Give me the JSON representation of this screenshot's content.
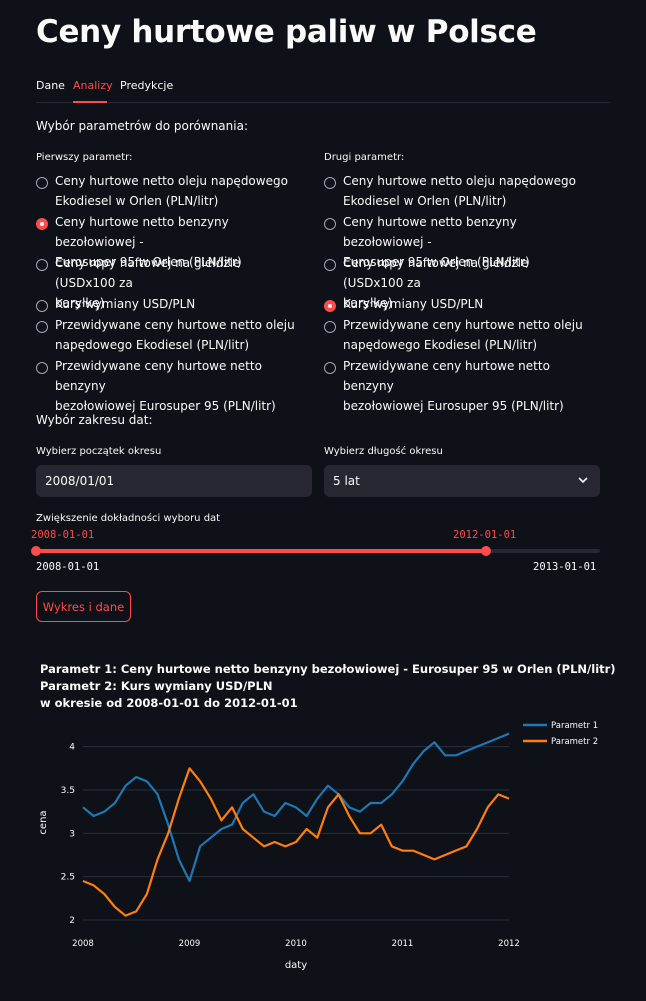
{
  "title": "Ceny hurtowe paliw w Polsce",
  "tabs": [
    "Dane",
    "Analizy",
    "Predykcje"
  ],
  "section_compare": "Wybór parametrów do porównania:",
  "first_param_label": "Pierwszy parametr:",
  "second_param_label": "Drugi parametr:",
  "options": {
    "o1": [
      "Ceny hurtowe netto oleju napędowego",
      "Ekodiesel w Orlen (PLN/litr)"
    ],
    "o2": [
      "Ceny hurtowe netto benzyny bezołowiowej -",
      "Eurosuper 95 w Orlen (PLN/litr)"
    ],
    "o3": [
      "Ceny ropy naftowej na giełdzie (USDx100 za",
      "baryłkę)"
    ],
    "o4": [
      "Kurs wymiany USD/PLN"
    ],
    "o5": [
      "Przewidywane ceny hurtowe netto oleju",
      "napędowego Ekodiesel (PLN/litr)"
    ],
    "o6": [
      "Przewidywane ceny hurtowe netto benzyny",
      "bezołowiowej Eurosuper 95 (PLN/litr)"
    ]
  },
  "first_selected": 2,
  "second_selected": 4,
  "section_range": "Wybór zakresu dat:",
  "start_label": "Wybierz początek okresu",
  "start_value": "2008/01/01",
  "length_label": "Wybierz długość okresu",
  "length_value": "5 lat",
  "slider_label": "Zwiększenie dokładności wyboru dat",
  "slider_low": "2008-01-01",
  "slider_high": "2012-01-01",
  "slider_min": "2008-01-01",
  "slider_max": "2013-01-01",
  "button_label": "Wykres i dane",
  "chart_title_1": "Parametr 1: Ceny hurtowe netto benzyny bezołowiowej - Eurosuper 95 w Orlen (PLN/litr)",
  "chart_title_2": "Parametr 2: Kurs wymiany USD/PLN",
  "chart_title_3": "w okresie od 2008-01-01 do 2012-01-01",
  "chart_data": {
    "type": "line",
    "xlabel": "daty",
    "ylabel": "cena",
    "xlim": [
      2008.0,
      2012.0
    ],
    "ylim": [
      2.0,
      4.25
    ],
    "xticks": [
      "2008",
      "2009",
      "2010",
      "2011",
      "2012"
    ],
    "yticks": [
      "2",
      "2.5",
      "3",
      "3.5",
      "4"
    ],
    "legend_position": "top-right",
    "grid": true,
    "x": [
      2008.0,
      2008.1,
      2008.2,
      2008.3,
      2008.4,
      2008.5,
      2008.6,
      2008.7,
      2008.8,
      2008.9,
      2009.0,
      2009.1,
      2009.2,
      2009.3,
      2009.4,
      2009.5,
      2009.6,
      2009.7,
      2009.8,
      2009.9,
      2010.0,
      2010.1,
      2010.2,
      2010.3,
      2010.4,
      2010.5,
      2010.6,
      2010.7,
      2010.8,
      2010.9,
      2011.0,
      2011.1,
      2011.2,
      2011.3,
      2011.4,
      2011.5,
      2011.6,
      2011.7,
      2011.8,
      2011.9,
      2012.0
    ],
    "series": [
      {
        "name": "Parametr 1",
        "color": "#1f77b4",
        "values": [
          3.3,
          3.2,
          3.25,
          3.35,
          3.55,
          3.65,
          3.6,
          3.45,
          3.1,
          2.7,
          2.45,
          2.85,
          2.95,
          3.05,
          3.1,
          3.35,
          3.45,
          3.25,
          3.2,
          3.35,
          3.3,
          3.2,
          3.4,
          3.55,
          3.45,
          3.3,
          3.25,
          3.35,
          3.35,
          3.45,
          3.6,
          3.8,
          3.95,
          4.05,
          3.9,
          3.9,
          3.95,
          4.0,
          4.05,
          4.1,
          4.15
        ]
      },
      {
        "name": "Parametr 2",
        "color": "#ff7f0e",
        "values": [
          2.45,
          2.4,
          2.3,
          2.15,
          2.05,
          2.1,
          2.3,
          2.7,
          3.0,
          3.4,
          3.75,
          3.6,
          3.4,
          3.15,
          3.3,
          3.05,
          2.95,
          2.85,
          2.9,
          2.85,
          2.9,
          3.05,
          2.95,
          3.3,
          3.45,
          3.2,
          3.0,
          3.0,
          3.1,
          2.85,
          2.8,
          2.8,
          2.75,
          2.7,
          2.75,
          2.8,
          2.85,
          3.05,
          3.3,
          3.45,
          3.4
        ]
      }
    ]
  }
}
